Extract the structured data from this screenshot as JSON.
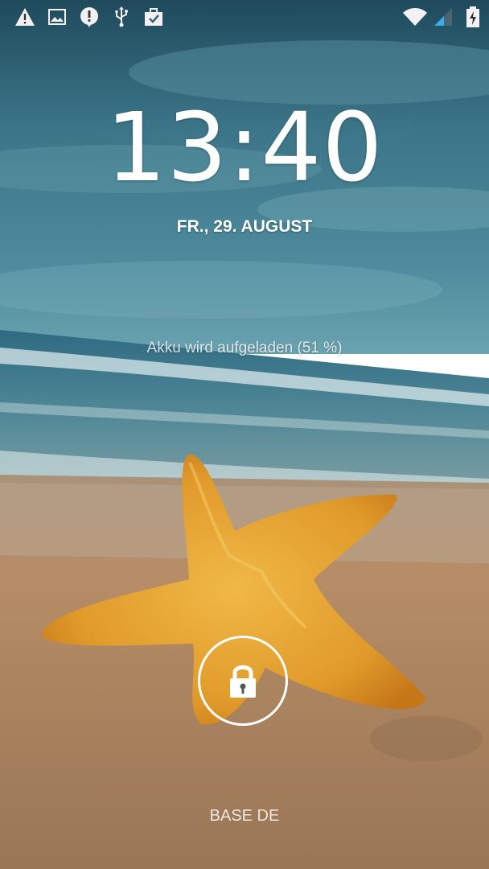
{
  "status_bar": {
    "left_icons": [
      "warning-icon",
      "image-icon",
      "alert-bubble-icon",
      "usb-icon",
      "briefcase-check-icon"
    ],
    "right_icons": [
      "wifi-icon",
      "signal-icon",
      "battery-charging-icon"
    ]
  },
  "lockscreen": {
    "time": "13:40",
    "date": "FR., 29. AUGUST",
    "charging_status": "Akku wird aufgeladen (51 %)",
    "carrier": "BASE DE",
    "battery_level": 0.51
  },
  "colors": {
    "sky_top": "#2f5f72",
    "sea": "#3f6f80",
    "sand": "#b8906a",
    "starfish": "#e0a030",
    "text": "#ffffff"
  }
}
